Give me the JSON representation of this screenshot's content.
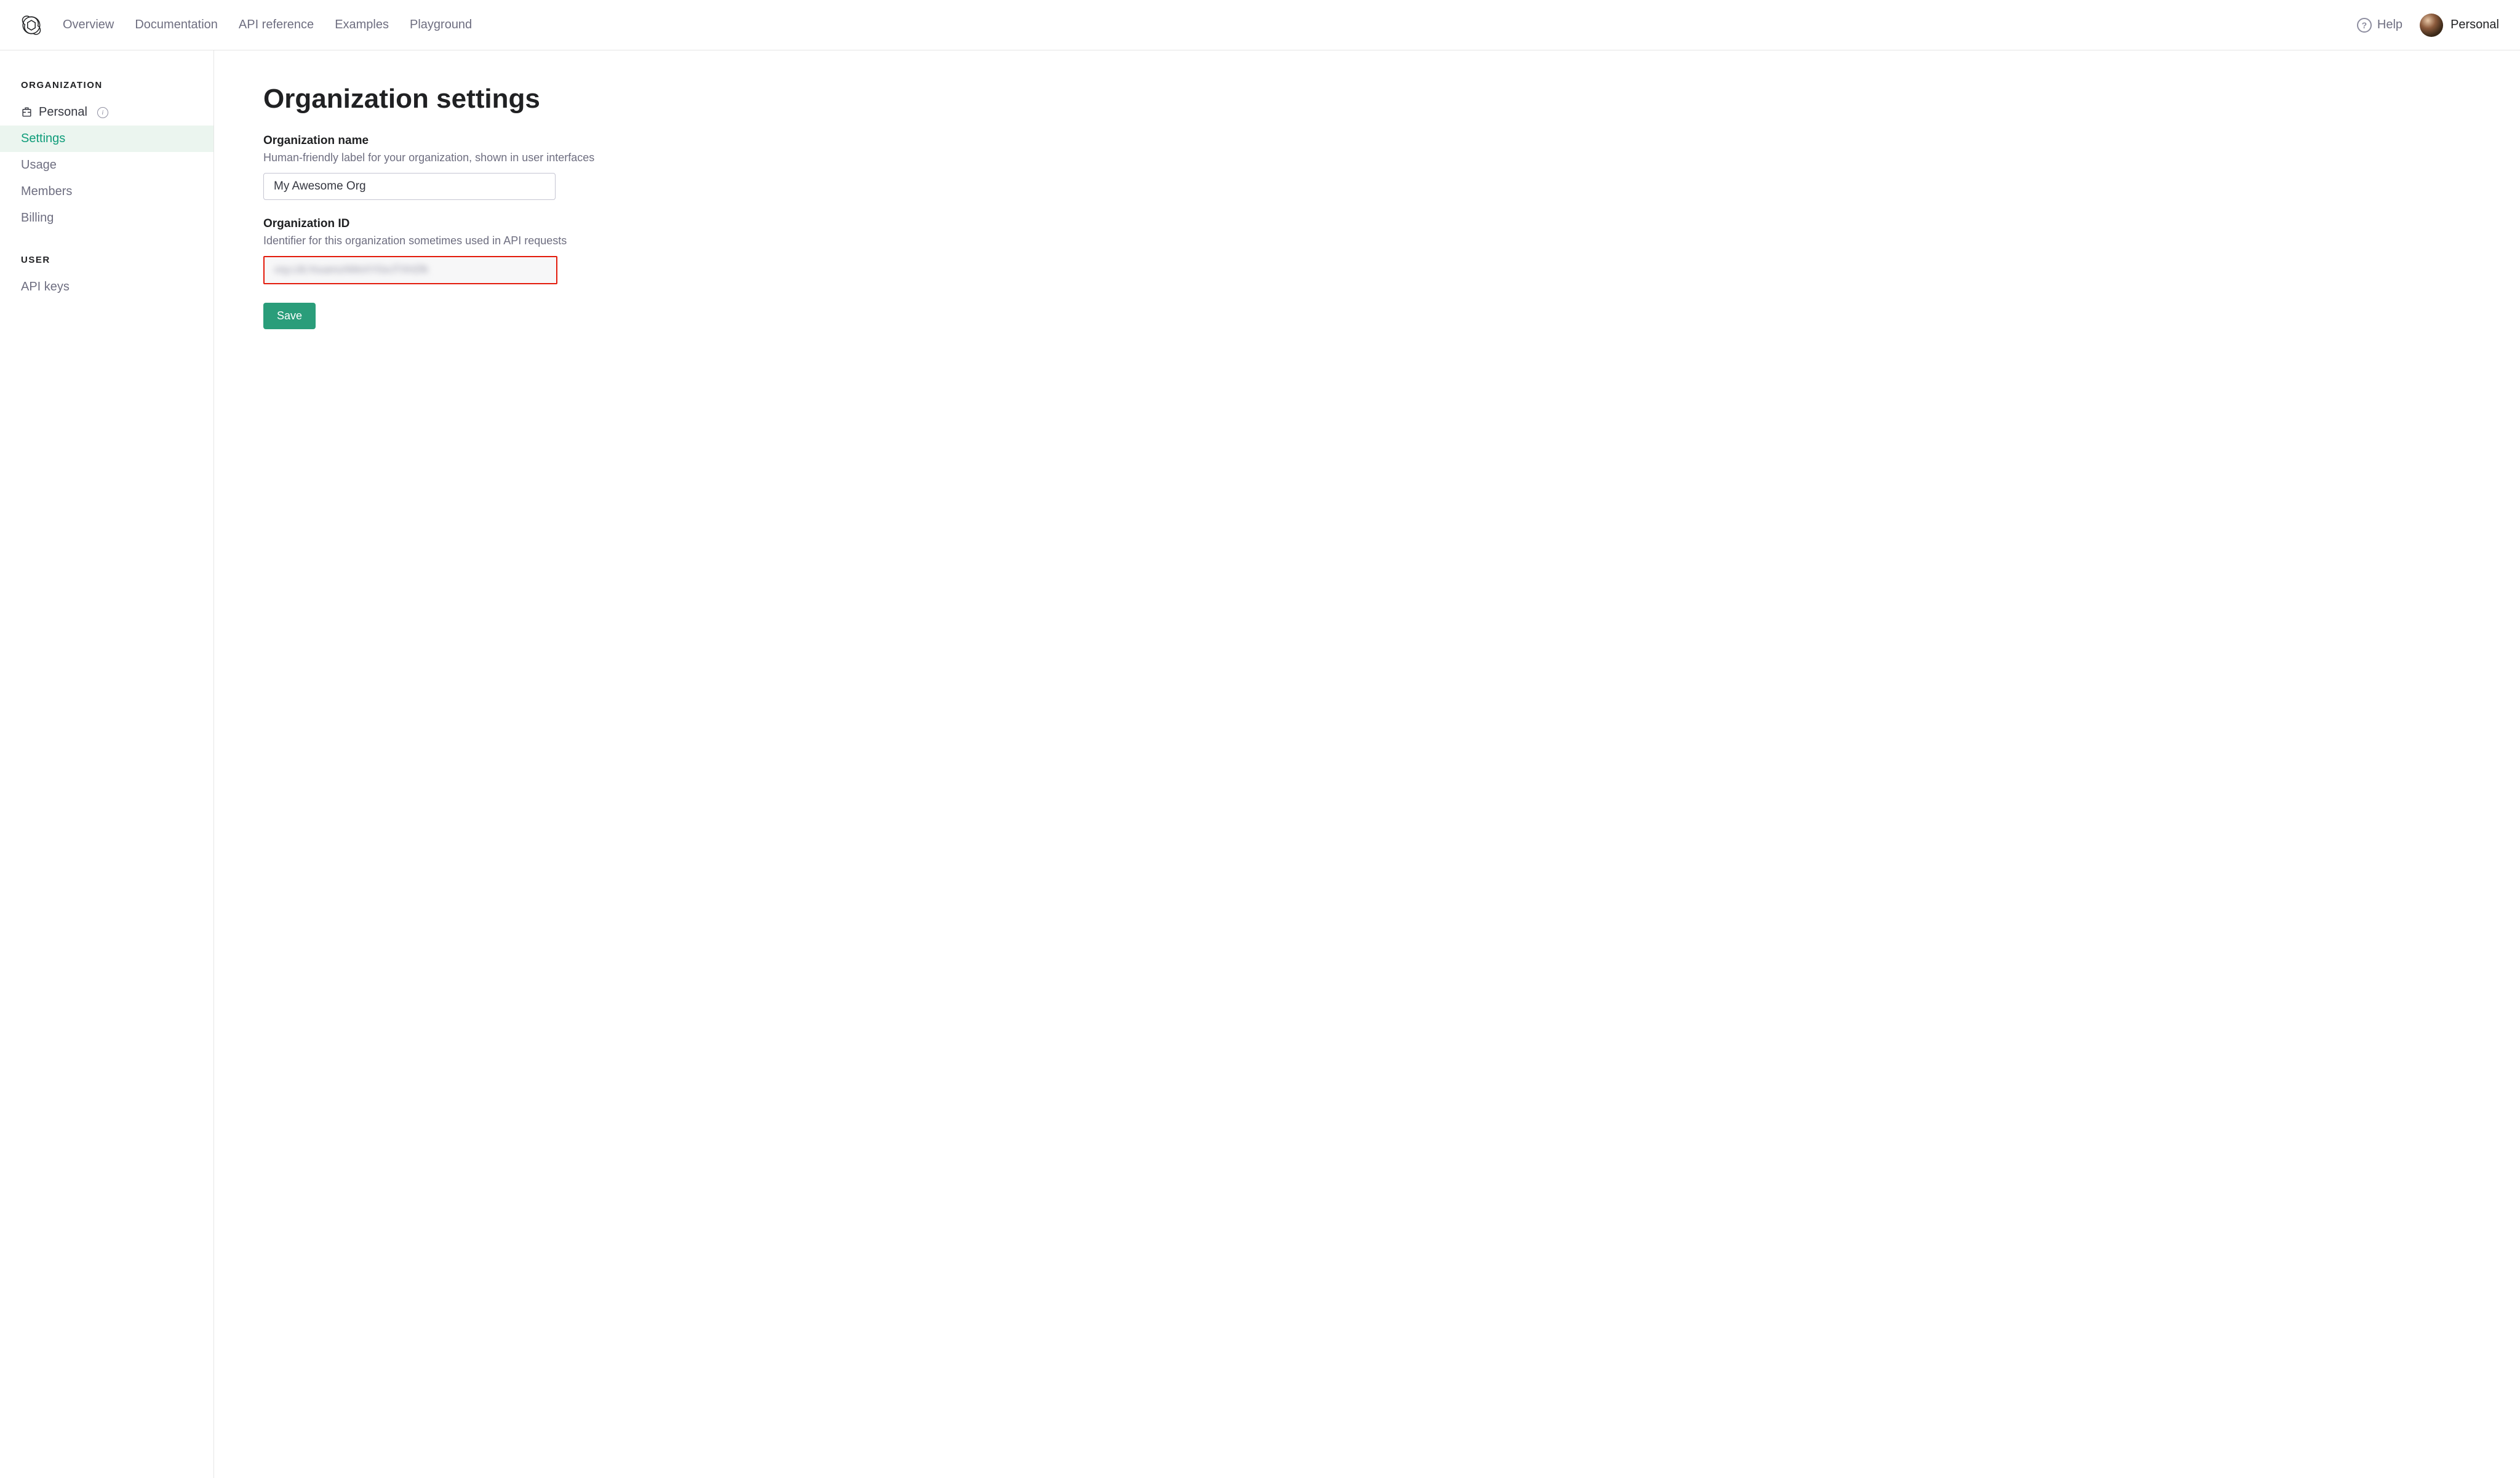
{
  "nav": {
    "items": [
      {
        "label": "Overview"
      },
      {
        "label": "Documentation"
      },
      {
        "label": "API reference"
      },
      {
        "label": "Examples"
      },
      {
        "label": "Playground"
      }
    ],
    "help": "Help",
    "account": "Personal"
  },
  "sidebar": {
    "org_heading": "ORGANIZATION",
    "org_name": "Personal",
    "items": [
      {
        "label": "Settings"
      },
      {
        "label": "Usage"
      },
      {
        "label": "Members"
      },
      {
        "label": "Billing"
      }
    ],
    "user_heading": "USER",
    "user_items": [
      {
        "label": "API keys"
      }
    ]
  },
  "main": {
    "title": "Organization settings",
    "org_name_label": "Organization name",
    "org_name_help": "Human-friendly label for your organization, shown in user interfaces",
    "org_name_value": "My Awesome Org",
    "org_id_label": "Organization ID",
    "org_id_help": "Identifier for this organization sometimes used in API requests",
    "org_id_value": "org-L8LYouamzAWeXYGeJTXHZfk",
    "save_label": "Save"
  }
}
